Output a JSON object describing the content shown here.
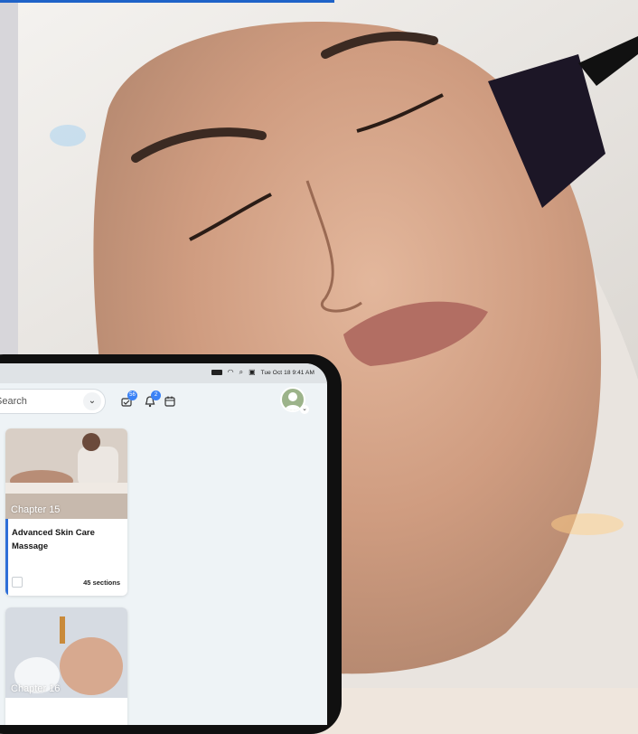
{
  "status_bar": {
    "time": "Tue Oct 18  9:41 AM",
    "icons": [
      "battery-icon",
      "wifi-icon",
      "search-icon",
      "control-center-icon"
    ]
  },
  "header": {
    "search_text": "Search",
    "search_chevron": "⌄",
    "icons": [
      {
        "name": "tasks-icon",
        "badge": "56"
      },
      {
        "name": "bell-icon",
        "badge": "2"
      },
      {
        "name": "calendar-icon",
        "badge": ""
      }
    ],
    "avatar_caret": "⌄"
  },
  "cards": [
    {
      "chapter": "Chapter 15",
      "title": "Advanced Skin Care Massage",
      "sections": "45 sections"
    },
    {
      "chapter": "Chapter 16",
      "title": "",
      "sections": ""
    }
  ],
  "colors": {
    "accent": "#2e6fd8",
    "badge": "#3b82f6",
    "screen_bg": "#eef3f6"
  }
}
